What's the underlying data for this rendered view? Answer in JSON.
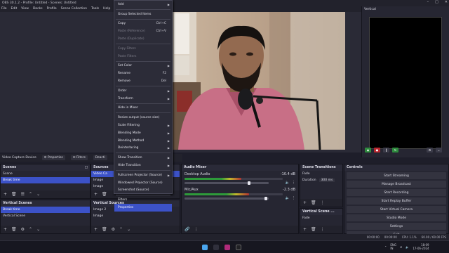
{
  "window": {
    "title": "OBS 30.1.2 - Profile: Untitled - Scenes: Untitled",
    "min_icon": "minimize-icon",
    "max_icon": "maximize-icon",
    "close_icon": "close-icon"
  },
  "menubar": [
    "File",
    "Edit",
    "View",
    "Docks",
    "Profile",
    "Scene Collection",
    "Tools",
    "Help"
  ],
  "context_menu": {
    "items": [
      {
        "label": "Add",
        "submenu": true,
        "enabled": true
      },
      {
        "sep": true
      },
      {
        "label": "Group Selected Items",
        "enabled": true
      },
      {
        "sep": true
      },
      {
        "label": "Copy",
        "shortcut": "Ctrl+C",
        "enabled": true
      },
      {
        "label": "Paste (Reference)",
        "shortcut": "Ctrl+V",
        "enabled": false
      },
      {
        "label": "Paste (Duplicate)",
        "enabled": false
      },
      {
        "sep": true
      },
      {
        "label": "Copy Filters",
        "enabled": false
      },
      {
        "label": "Paste Filters",
        "enabled": false
      },
      {
        "sep": true
      },
      {
        "label": "Set Color",
        "submenu": true,
        "enabled": true
      },
      {
        "label": "Rename",
        "shortcut": "F2",
        "enabled": true
      },
      {
        "label": "Remove",
        "shortcut": "Del",
        "enabled": true
      },
      {
        "sep": true
      },
      {
        "label": "Order",
        "submenu": true,
        "enabled": true
      },
      {
        "label": "Transform",
        "submenu": true,
        "enabled": true
      },
      {
        "sep": true
      },
      {
        "label": "Hide in Mixer",
        "enabled": true
      },
      {
        "sep": true
      },
      {
        "label": "Resize output (source size)",
        "enabled": true
      },
      {
        "label": "Scale Filtering",
        "submenu": true,
        "enabled": true
      },
      {
        "label": "Blending Mode",
        "submenu": true,
        "enabled": true
      },
      {
        "label": "Blending Method",
        "submenu": true,
        "enabled": true
      },
      {
        "label": "Deinterlacing",
        "submenu": true,
        "enabled": true
      },
      {
        "sep": true
      },
      {
        "label": "Show Transition",
        "submenu": true,
        "enabled": true
      },
      {
        "label": "Hide Transition",
        "submenu": true,
        "enabled": true
      },
      {
        "sep": true
      },
      {
        "label": "Fullscreen Projector (Source)",
        "submenu": true,
        "enabled": true
      },
      {
        "label": "Windowed Projector (Source)",
        "enabled": true
      },
      {
        "label": "Screenshot (Source)",
        "enabled": true
      },
      {
        "sep": true
      },
      {
        "label": "Filters",
        "enabled": true
      },
      {
        "label": "Properties",
        "enabled": true,
        "highlighted": true
      }
    ]
  },
  "vertical_dock": {
    "title": "Vertical"
  },
  "source_toolbar": {
    "source_name": "Video Capture Device",
    "properties": "Properties",
    "filters": "Filters",
    "deactivate": "Deacti"
  },
  "scenes": {
    "title": "Scenes",
    "items": [
      {
        "label": "Scene",
        "selected": false
      },
      {
        "label": "Break time",
        "selected": true
      }
    ]
  },
  "sources": {
    "title": "Sources",
    "items": [
      {
        "label": "Video Ca",
        "selected": true
      },
      {
        "label": "Image",
        "selected": false
      },
      {
        "label": "Image",
        "selected": false
      }
    ]
  },
  "audio_mixer": {
    "title": "Audio Mixer",
    "channels": [
      {
        "name": "Desktop Audio",
        "db": "-10.4 dB",
        "level": 0.58,
        "fader": 0.75
      },
      {
        "name": "Mic/Aux",
        "db": "-2.3 dB",
        "level": 0.66,
        "fader": 0.95
      }
    ]
  },
  "transitions": {
    "title": "Scene Transitions",
    "type": "Fade",
    "duration_label": "Duration",
    "duration": "300 ms"
  },
  "controls": {
    "title": "Controls",
    "buttons": [
      "Start Streaming",
      "Manage Broadcast",
      "Start Recording",
      "Start Replay Buffer",
      "Start Virtual Camera",
      "Studio Mode",
      "Settings",
      "Exit"
    ]
  },
  "vertical_scenes": {
    "title": "Vertical Scenes",
    "items": [
      {
        "label": "Break time",
        "selected": true
      },
      {
        "label": "Vertical Scene",
        "selected": false
      }
    ]
  },
  "vertical_sources": {
    "title": "Vertical Sources",
    "items": [
      {
        "label": "Image 2"
      },
      {
        "label": "Image"
      }
    ]
  },
  "vertical_transitions": {
    "title": "Vertical Scene ...",
    "type": "Fade"
  },
  "status": {
    "time1": "00:00:00",
    "time2": "00:00:00",
    "cpu": "CPU: 1.1%",
    "fps": "60.00 / 60.00 FPS"
  },
  "taskbar": {
    "lang1": "ENG",
    "lang2": "IN",
    "clock_time": "18:09",
    "clock_date": "17-06-2024"
  },
  "accents": {
    "selection": "#3c52c8",
    "record_red": "#b8262e",
    "green": "#2e8a3e"
  }
}
